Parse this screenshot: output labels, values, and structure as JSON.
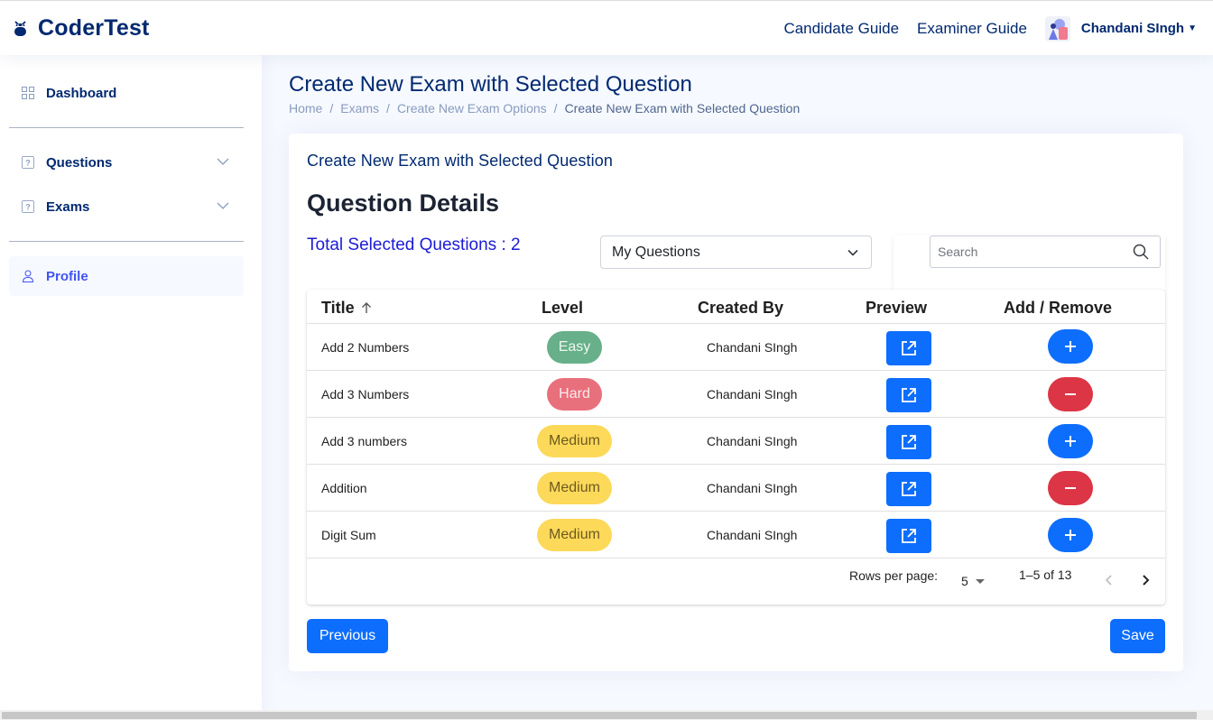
{
  "header": {
    "logo_text": "CoderTest",
    "nav_links": [
      "Candidate Guide",
      "Examiner Guide"
    ],
    "user_name": "Chandani SIngh"
  },
  "sidebar": {
    "items": [
      {
        "label": "Dashboard",
        "icon": "grid-icon"
      },
      {
        "label": "Questions",
        "icon": "question-square-icon"
      },
      {
        "label": "Exams",
        "icon": "question-square-icon"
      },
      {
        "label": "Profile",
        "icon": "person-icon"
      }
    ]
  },
  "page": {
    "title": "Create New Exam with Selected Question",
    "breadcrumb": [
      "Home",
      "Exams",
      "Create New Exam Options",
      "Create New Exam with Selected Question"
    ]
  },
  "card": {
    "title": "Create New Exam with Selected Question",
    "section_title": "Question Details",
    "total_selected": "Total Selected Questions : 2",
    "filter_selected": "My Questions",
    "search_placeholder": "Search"
  },
  "table": {
    "headers": [
      "Title",
      "Level",
      "Created By",
      "Preview",
      "Add / Remove"
    ],
    "rows": [
      {
        "title": "Add 2 Numbers",
        "level": "Easy",
        "created_by": "Chandani SIngh",
        "action": "add"
      },
      {
        "title": "Add 3 Numbers",
        "level": "Hard",
        "created_by": "Chandani SIngh",
        "action": "remove"
      },
      {
        "title": "Add 3 numbers",
        "level": "Medium",
        "created_by": "Chandani SIngh",
        "action": "add"
      },
      {
        "title": "Addition",
        "level": "Medium",
        "created_by": "Chandani SIngh",
        "action": "remove"
      },
      {
        "title": "Digit Sum",
        "level": "Medium",
        "created_by": "Chandani SIngh",
        "action": "add"
      }
    ],
    "pagination": {
      "rows_per_page_label": "Rows per page:",
      "rows_per_page": "5",
      "range": "1–5 of 13"
    }
  },
  "buttons": {
    "previous": "Previous",
    "save": "Save"
  },
  "colors": {
    "primary": "#0d6efd",
    "danger": "#dc3545",
    "easy": "#67b08a",
    "hard": "#e8707c",
    "medium": "#fdd95a",
    "brand_navy": "#012970"
  }
}
